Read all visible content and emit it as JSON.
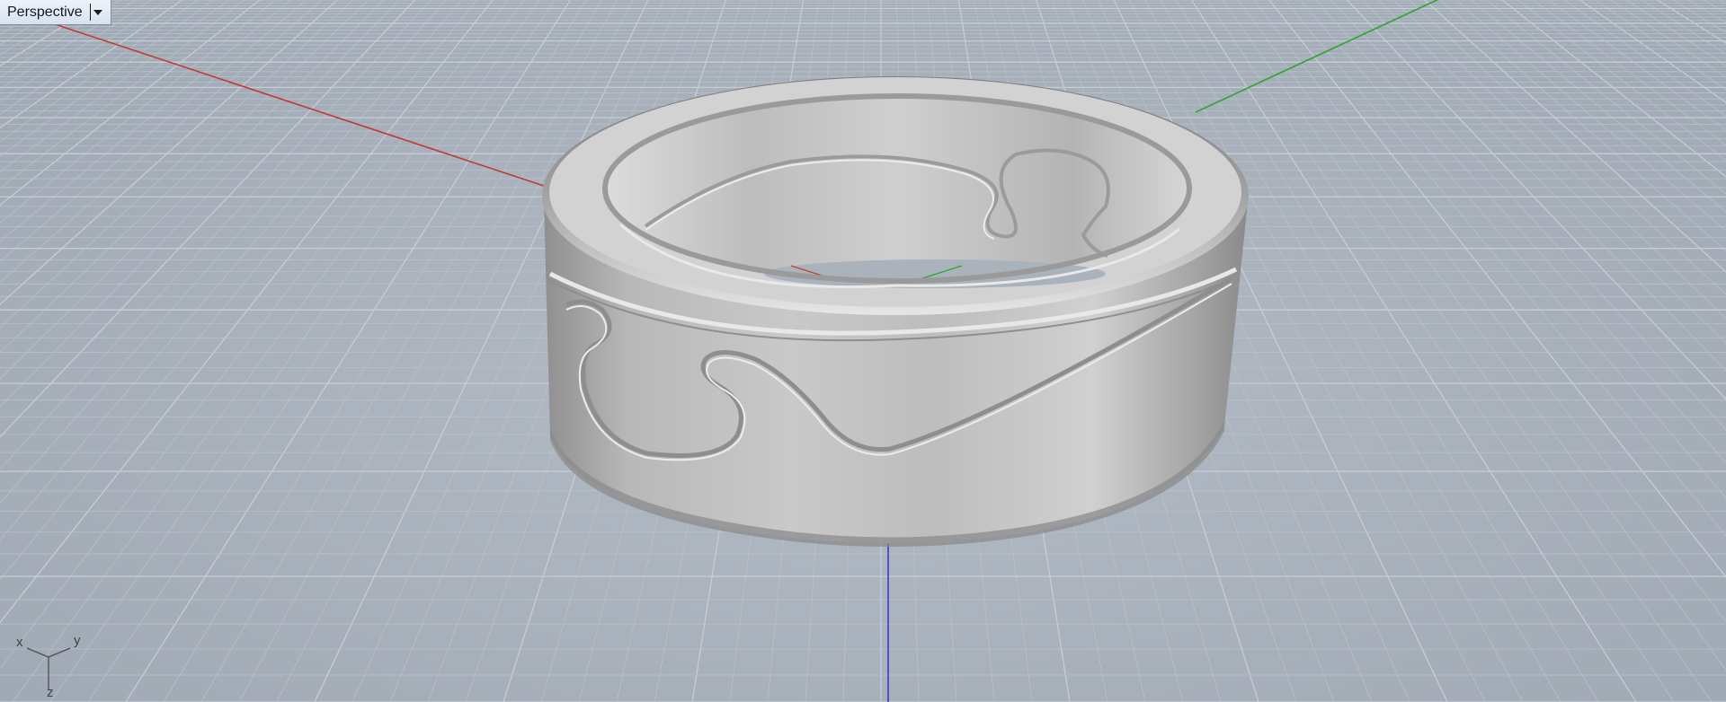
{
  "viewport": {
    "title": "Perspective",
    "menu_icon": "chevron-down-icon"
  },
  "axis_widget": {
    "x_label": "x",
    "y_label": "y",
    "z_label": "z"
  },
  "colors": {
    "x_axis": "#c03a32",
    "y_axis": "#2fa52f",
    "z_axis": "#3a3ac8",
    "metal": "#c6c6c6",
    "background": "#a9b2bd"
  }
}
